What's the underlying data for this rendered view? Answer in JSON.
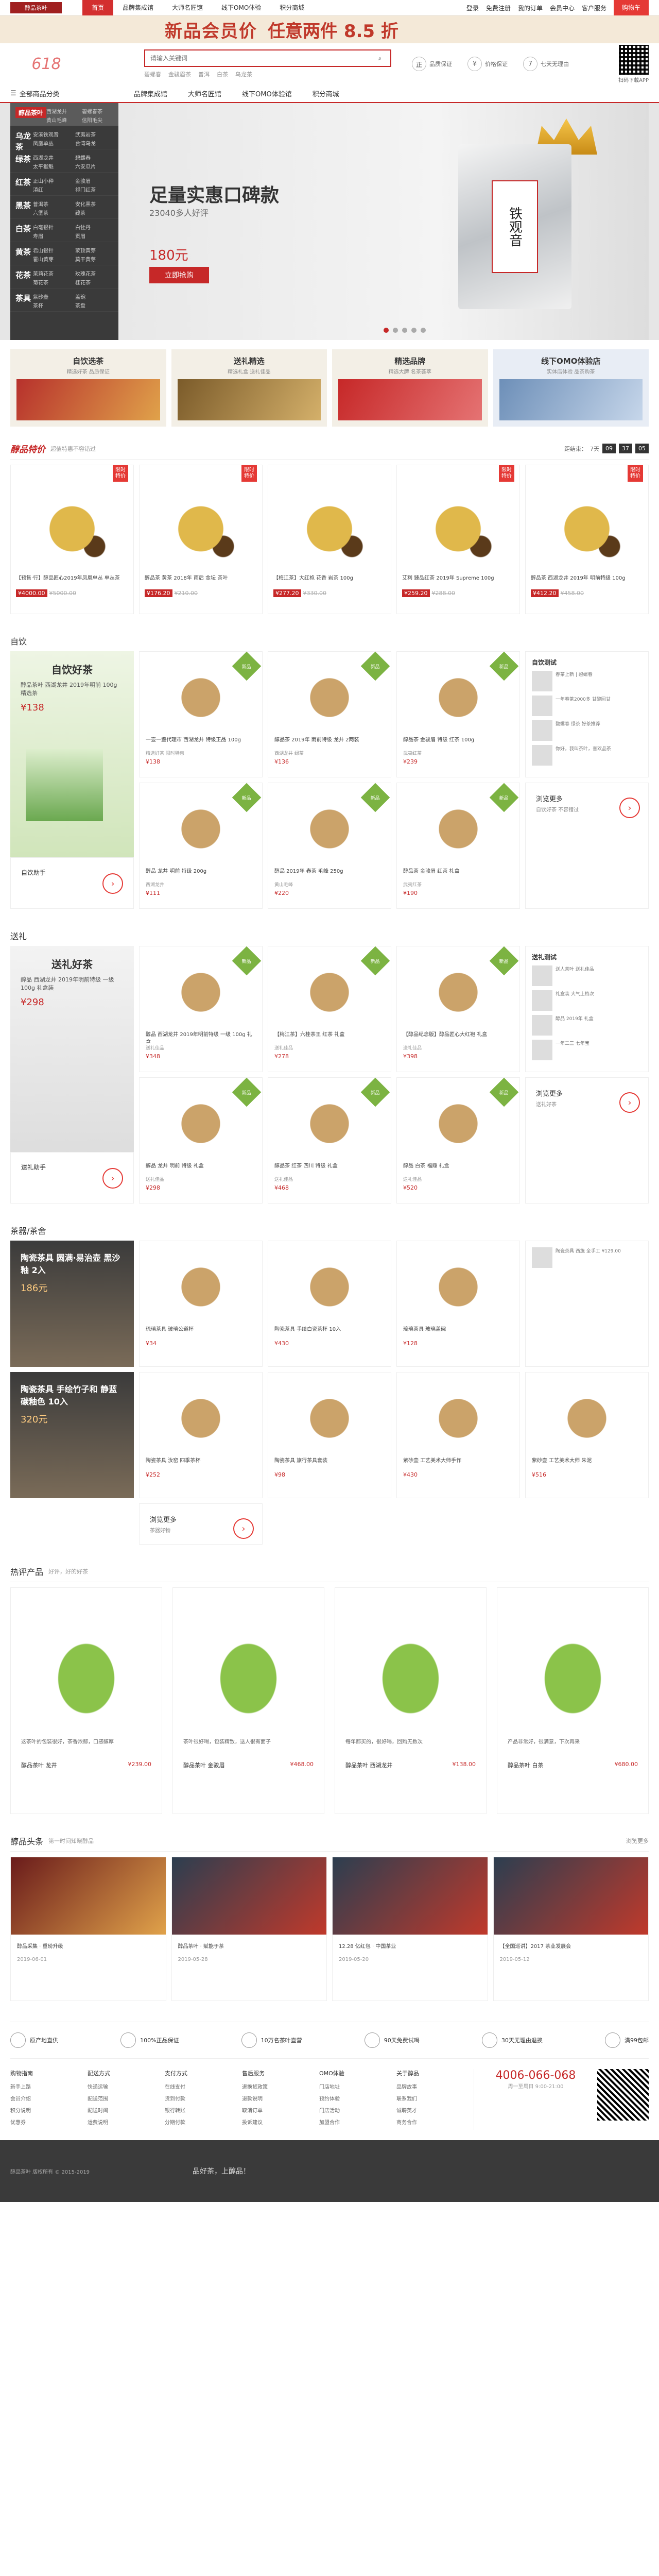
{
  "topnav": {
    "logo": "醇品茶叶",
    "items": [
      "首页",
      "品牌集成馆",
      "大师名匠馆",
      "线下OMO体验",
      "积分商城"
    ],
    "right": [
      "登录",
      "免费注册",
      "我的订单",
      "会员中心",
      "客户服务",
      "购物车"
    ]
  },
  "promo": {
    "text1": "新品会员价",
    "text2": "任意两件 8.5 折"
  },
  "header": {
    "logo": "618",
    "search_placeholder": "请输入关键词",
    "hot": [
      "碧螺春",
      "金骏眉茶",
      "普洱",
      "白茶",
      "乌龙茶"
    ],
    "icons": [
      {
        "icon": "正",
        "t": "品质保证"
      },
      {
        "icon": "¥",
        "t": "价格保证"
      },
      {
        "icon": "7",
        "t": "七天无理由"
      }
    ],
    "qr_label": "扫码下载APP"
  },
  "mainnav": {
    "cat": "全部商品分类",
    "items": [
      "品牌集成馆",
      "大师名匠馆",
      "线下OMO体验馆",
      "积分商城"
    ]
  },
  "side": [
    {
      "big": "醇品茶叶",
      "subs": [
        "西湖龙井",
        "碧螺春茶",
        "黄山毛峰",
        "信阳毛尖"
      ]
    },
    {
      "big": "乌龙茶",
      "subs": [
        "安溪铁观音",
        "武夷岩茶",
        "凤凰单丛",
        "台湾乌龙"
      ]
    },
    {
      "big": "绿茶",
      "subs": [
        "西湖龙井",
        "碧螺春",
        "太平猴魁",
        "六安瓜片"
      ]
    },
    {
      "big": "红茶",
      "subs": [
        "正山小种",
        "金骏眉",
        "滇红",
        "祁门红茶"
      ]
    },
    {
      "big": "黑茶",
      "subs": [
        "普洱茶",
        "安化黑茶",
        "六堡茶",
        "藏茶"
      ]
    },
    {
      "big": "白茶",
      "subs": [
        "白毫银针",
        "白牡丹",
        "寿眉",
        "贡眉"
      ]
    },
    {
      "big": "黄茶",
      "subs": [
        "君山银针",
        "蒙顶黄芽",
        "霍山黄芽",
        "莫干黄芽"
      ]
    },
    {
      "big": "花茶",
      "subs": [
        "茉莉花茶",
        "玫瑰花茶",
        "菊花茶",
        "桂花茶"
      ]
    },
    {
      "big": "茶具",
      "subs": [
        "紫砂壶",
        "盖碗",
        "茶杯",
        "茶盘"
      ]
    }
  ],
  "hero": {
    "title": "足量实惠口碑款",
    "sub": "23040多人好评",
    "price": "180元",
    "btn": "立即抢购",
    "pkg": "铁观音"
  },
  "tiles": [
    {
      "t": "自饮选茶",
      "s": "精选好茶 品质保证"
    },
    {
      "t": "送礼精选",
      "s": "精选礼盒 送礼佳品"
    },
    {
      "t": "精选品牌",
      "s": "精选大牌 名茶荟萃"
    },
    {
      "t": "线下OMO体验店",
      "s": "实体店体验 品茶购茶"
    }
  ],
  "flash": {
    "title": "醇品特价",
    "sub": "超值特惠不容错过",
    "cd_label": "距结束：",
    "cd": [
      "7天",
      "09",
      "37",
      "05"
    ],
    "items": [
      {
        "tag": "限时特价",
        "nm": "【预售·行】醇品匠心2019年凤凰单丛 单丛茶",
        "p": "¥4000.00",
        "o": "¥5000.00"
      },
      {
        "tag": "限时特价",
        "nm": "醇品茶 黄茶 2018年 雨后 金坛 茶叶",
        "p": "¥176.20",
        "o": "¥210.00"
      },
      {
        "tag": "",
        "nm": "【梅江茶】大红袍 花香 岩茶 100g",
        "p": "¥277.20",
        "o": "¥330.00"
      },
      {
        "tag": "限时特价",
        "nm": "艾利 臻品红茶 2019年 Supreme 100g",
        "p": "¥259.20",
        "o": "¥288.00"
      },
      {
        "tag": "限时特价",
        "nm": "醇品茶 西湖龙井 2019年 明前特级 100g",
        "p": "¥412.20",
        "o": "¥458.00"
      }
    ]
  },
  "floor1": {
    "title": "自饮",
    "big": {
      "h": "自饮好茶",
      "d": "醇品茶叶 西湖龙井 2019年明前 100g 精选茶",
      "p": "¥138",
      "help": "自饮助手"
    },
    "items": [
      {
        "n": "一壶一盏代理市 西湖龙井 特级正品 100g",
        "d": "精选好茶 限时特惠",
        "p": "¥138"
      },
      {
        "n": "醇品茶 2019年 雨前特级 龙井 2两装",
        "d": "西湖龙井 绿茶",
        "p": "¥136"
      },
      {
        "n": "醇品茶 金骏眉 特级 红茶 100g",
        "d": "武夷红茶",
        "p": "¥239"
      },
      {
        "n": "醇品 龙井 明前 特级 200g",
        "d": "西湖龙井",
        "p": "¥111"
      },
      {
        "n": "醇品 2019年 春茶 毛峰 250g",
        "d": "黄山毛峰",
        "p": "¥220"
      },
      {
        "n": "醇品茶 金骏眉 红茶 礼盒",
        "d": "武夷红茶",
        "p": "¥190"
      }
    ],
    "list": {
      "h": "自饮测试",
      "rows": [
        "春茶上新 | 碧螺春",
        "一年春茶2000多 甘醇回甘",
        "碧螺春 绿茶 好茶推荐",
        "你好，我叫茶叶，喜欢品茶"
      ]
    },
    "more": {
      "t": "浏览更多",
      "s": "自饮好茶 不容错过"
    }
  },
  "floor2": {
    "title": "送礼",
    "big": {
      "h": "送礼好茶",
      "d": "醇品 西湖龙井 2019年明前特级 一级 100g 礼盒装",
      "p": "¥298",
      "help": "送礼助手"
    },
    "items": [
      {
        "n": "醇品 西湖龙井 2019年明前特级 一级 100g 礼盒",
        "d": "送礼佳品",
        "p": "¥348"
      },
      {
        "n": "【梅江茶】六桂茶王 红茶 礼盒",
        "d": "送礼佳品",
        "p": "¥278"
      },
      {
        "n": "【醇品纪念版】醇品匠心大红袍 礼盒",
        "d": "送礼佳品",
        "p": "¥398"
      },
      {
        "n": "醇品 龙井 明前 特级 礼盒",
        "d": "送礼佳品",
        "p": "¥298"
      },
      {
        "n": "醇品茶 红茶 四川 特级 礼盒",
        "d": "送礼佳品",
        "p": "¥468"
      },
      {
        "n": "醇品 白茶 福鼎 礼盒",
        "d": "送礼佳品",
        "p": "¥520"
      }
    ],
    "list": {
      "h": "送礼测试",
      "rows": [
        "送人茶叶 送礼佳品",
        "礼盒装 大气上档次",
        "醇品 2019年 礼盒",
        "一年二三 七年宝"
      ]
    },
    "more": {
      "t": "浏览更多",
      "s": "送礼好茶"
    }
  },
  "floor3": {
    "title": "茶器/茶舍",
    "big": {
      "h": "陶瓷茶具 圆满·易治壶 黑沙釉 2入",
      "p": "186元"
    },
    "big2": {
      "h": "陶瓷茶具 手绘竹子和 静蓝碳釉色 10入",
      "p": "320元"
    },
    "items": [
      {
        "n": "琉璃茶具 玻璃公道杯",
        "d": "",
        "p": "¥34"
      },
      {
        "n": "陶瓷茶具 手绘白瓷茶杯 10入",
        "d": "",
        "p": "¥430"
      },
      {
        "n": "琉璃茶具 玻璃盖碗",
        "d": "",
        "p": "¥128"
      },
      {
        "n": "陶瓷茶具 汝窑 四季茶杯",
        "d": "",
        "p": "¥252"
      },
      {
        "n": "陶瓷茶具 旅行茶具套装",
        "d": "",
        "p": "¥98"
      },
      {
        "n": "紫砂壶 工艺美术大师手作",
        "d": "",
        "p": "¥430"
      },
      {
        "n": "紫砂壶 工艺美术大师 朱泥",
        "d": "",
        "p": "¥516"
      }
    ],
    "list": {
      "h": "",
      "rows": [
        "陶瓷茶具 西施 全手工 ¥129.00"
      ]
    },
    "more": {
      "t": "浏览更多",
      "s": "茶器好物"
    }
  },
  "hot": {
    "title": "热评产品",
    "sub": "好评，好的好茶",
    "items": [
      {
        "t": "这茶叶的包装很好，茶香浓郁，口感醇厚",
        "n": "醇品茶叶 龙井",
        "p": "¥239.00"
      },
      {
        "t": "茶叶很好喝，包装精致，送人很有面子",
        "n": "醇品茶叶 金骏眉",
        "p": "¥468.00"
      },
      {
        "t": "每年都买的，很好喝，回购无数次",
        "n": "醇品茶叶 西湖龙井",
        "p": "¥138.00"
      },
      {
        "t": "产品非常好，很满意，下次再来",
        "n": "醇品茶叶 白茶",
        "p": "¥680.00"
      }
    ]
  },
  "news": {
    "title": "醇品头条",
    "sub": "第一时间知晓醇品",
    "more": "浏览更多",
    "items": [
      {
        "t": "醇品采集 · 重磅升级",
        "d": "2019-06-01"
      },
      {
        "t": "醇品茶叶 · 赋能于茶",
        "d": "2019-05-28"
      },
      {
        "t": "12.28 亿红包 · 中国茶业",
        "d": "2019-05-20"
      },
      {
        "t": "【全国巡讲】2017 茶业发展会",
        "d": "2019-05-12"
      }
    ]
  },
  "service": [
    "原产地直供",
    "100%正品保证",
    "10万名茶叶直营",
    "90天免费试喝",
    "30天无理由退换",
    "满99包邮"
  ],
  "links": [
    {
      "h": "购物指南",
      "r": [
        "新手上路",
        "会员介绍",
        "积分说明",
        "优惠券"
      ]
    },
    {
      "h": "配送方式",
      "r": [
        "快递运输",
        "配送范围",
        "配送时间",
        "运费说明"
      ]
    },
    {
      "h": "支付方式",
      "r": [
        "在线支付",
        "货到付款",
        "银行转账",
        "分期付款"
      ]
    },
    {
      "h": "售后服务",
      "r": [
        "退换货政策",
        "退款说明",
        "取消订单",
        "投诉建议"
      ]
    },
    {
      "h": "OMO体验",
      "r": [
        "门店地址",
        "预约体验",
        "门店活动",
        "加盟合作"
      ]
    },
    {
      "h": "关于醇品",
      "r": [
        "品牌故事",
        "联系我们",
        "诚聘英才",
        "商务合作"
      ]
    }
  ],
  "phone": {
    "n": "4006-066-068",
    "s": "周一至周日 9:00-21:00"
  },
  "footer": {
    "t": "醇品茶叶 版权所有 © 2015-2019",
    "s": "品好茶，上醇品！"
  },
  "colors": {
    "accent": "#c62828"
  }
}
